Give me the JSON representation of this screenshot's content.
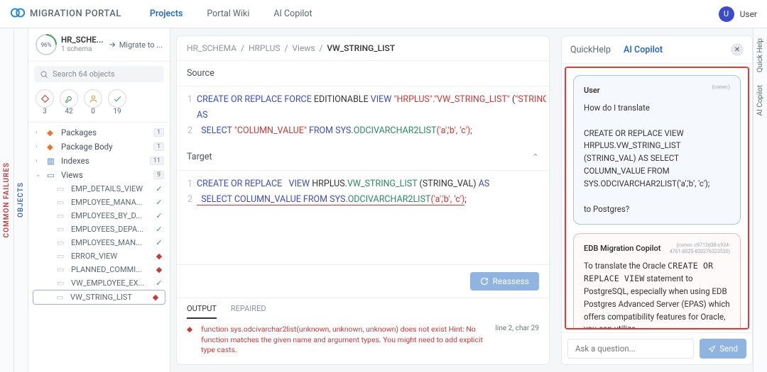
{
  "brand": {
    "name": "MIGRATION PORTAL"
  },
  "topnav": {
    "projects": "Projects",
    "wiki": "Portal Wiki",
    "copilot": "AI Copilot"
  },
  "user": {
    "initial": "U",
    "name": "User"
  },
  "rails": {
    "objects": "OBJECTS",
    "failures": "COMMON FAILURES",
    "quickhelp": "Quick Help",
    "aicopilot": "AI Copilot"
  },
  "project": {
    "percent": "96%",
    "name": "HR_SCHE...",
    "sub": "1 schema",
    "migrate": "Migrate to ..."
  },
  "search": {
    "placeholder": "Search 64 objects"
  },
  "filters": {
    "error": "3",
    "wrench": "42",
    "person": "0",
    "check": "19"
  },
  "tree": {
    "groups": [
      {
        "chev": "›",
        "icon": "pkg",
        "label": "Packages",
        "count": "1"
      },
      {
        "chev": "›",
        "icon": "pkg",
        "label": "Package Body",
        "count": "1"
      },
      {
        "chev": "›",
        "icon": "idx",
        "label": "Indexes",
        "count": "11"
      },
      {
        "chev": "⌄",
        "icon": "view",
        "label": "Views",
        "count": "9"
      }
    ],
    "leaves": [
      {
        "label": "EMP_DETAILS_VIEW",
        "status": "ok"
      },
      {
        "label": "EMPLOYEE_MANA...",
        "status": "ok"
      },
      {
        "label": "EMPLOYEES_BY_D...",
        "status": "ok"
      },
      {
        "label": "EMPLOYEES_DEPA...",
        "status": "ok"
      },
      {
        "label": "EMPLOYEES_MAN...",
        "status": "ok"
      },
      {
        "label": "ERROR_VIEW",
        "status": "err"
      },
      {
        "label": "PLANNED_COMMI...",
        "status": "err"
      },
      {
        "label": "VW_EMPLOYEE_EX...",
        "status": "ok"
      },
      {
        "label": "VW_STRING_LIST",
        "status": "err",
        "selected": true
      }
    ]
  },
  "breadcrumb": {
    "a": "HR_SCHEMA",
    "b": "HRPLUS",
    "c": "Views",
    "d": "VW_STRING_LIST",
    "sep": "/"
  },
  "source": {
    "header": "Source",
    "line1a": "CREATE OR REPLACE FORCE ",
    "line1b": "EDITIONABLE",
    "line1c": " VIEW ",
    "line1d": "\"HRPLUS\".\"VW_STRING_LIST\"",
    "line1e": " (",
    "line1f": "\"STRING_VAL\"",
    "line1g": ")",
    "line1h": "AS",
    "line2a": "  SELECT ",
    "line2b": "\"COLUMN_VALUE\"",
    "line2c": " FROM SYS.",
    "line2d": "ODCIVARCHAR2LIST",
    "line2e": "('a','b', 'c');"
  },
  "target": {
    "header": "Target",
    "line1a": "CREATE OR REPLACE   VIEW ",
    "line1b": "HRPLUS",
    "line1c": ".",
    "line1d": "VW_STRING_LIST",
    "line1e": " (STRING_VAL) ",
    "line1f": "AS",
    "line2a": "  SELECT COLUMN_VALUE FROM SYS.",
    "line2b": "ODCIVARCHAR2LIST",
    "line2c": "('a','b', 'c')",
    "line2d": ";"
  },
  "reassess": "Reassess",
  "centerTabs": {
    "output": "OUTPUT",
    "repaired": "REPAIRED"
  },
  "error": {
    "msg": "function sys.odcivarchar2list(unknown, unknown, unknown) does not exist Hint: No function matches the given name and argument types. You might need to add explicit type casts.",
    "loc": "line 2, char 29"
  },
  "chat": {
    "tabs": {
      "quickhelp": "QuickHelp",
      "copilot": "AI Copilot"
    },
    "user": {
      "who": "User",
      "meta": "(convo:)",
      "p1": "How do I translate",
      "p2": "CREATE OR REPLACE VIEW HRPLUS.VW_STRING_LIST (STRING_VAL) AS SELECT COLUMN_VALUE FROM SYS.ODCIVARCHAR2LIST('a','b', 'c');",
      "p3": "to Postgres?"
    },
    "bot": {
      "who": "EDB Migration Copilot",
      "meta": "(convo: c9712d38-c924-4761-8025-830276323530)",
      "p1a": "To translate the Oracle ",
      "p1b": "CREATE OR REPLACE VIEW",
      "p1c": " statement to PostgreSQL, especially when using EDB Postgres Advanced Server (EPAS) which offers compatibility features for Oracle, you can utilize"
    },
    "input": {
      "placeholder": "Ask a question...",
      "send": "Send"
    }
  }
}
